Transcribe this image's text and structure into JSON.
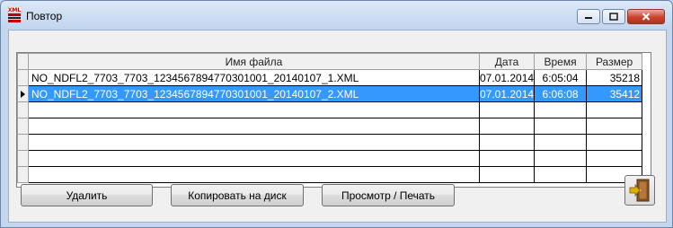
{
  "window": {
    "title": "Повтор",
    "app_icon": "xml-file-icon",
    "controls": [
      "minimize",
      "maximize",
      "close"
    ]
  },
  "grid": {
    "columns": [
      "Имя файла",
      "Дата",
      "Время",
      "Размер"
    ],
    "rows": [
      {
        "name": "NO_NDFL2_7703_7703_1234567894770301001_20140107_1.XML",
        "date": "07.01.2014",
        "time": "6:05:04",
        "size": "35218"
      },
      {
        "name": "NO_NDFL2_7703_7703_1234567894770301001_20140107_2.XML",
        "date": "07.01.2014",
        "time": "6:06:08",
        "size": "35412"
      }
    ],
    "selected_row": 2
  },
  "buttons": {
    "delete": "Удалить",
    "copy_to_disk": "Копировать на диск",
    "view_print": "Просмотр / Печать",
    "exit_icon": "exit-door-icon"
  }
}
